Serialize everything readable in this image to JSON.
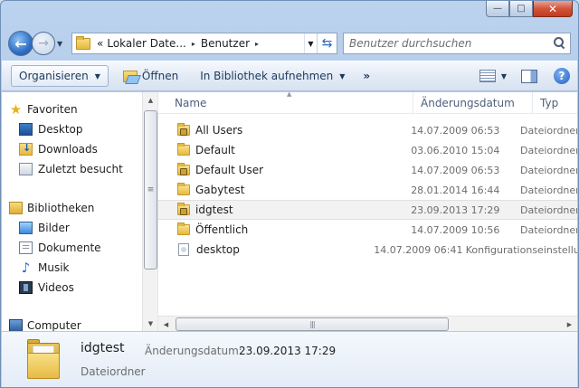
{
  "window": {
    "minimize_glyph": "—",
    "maximize_glyph": "□",
    "close_glyph": "✕"
  },
  "address_bar": {
    "overflow": "«",
    "segments": [
      "Lokaler Date...",
      "Benutzer"
    ],
    "separator": "▸"
  },
  "search": {
    "placeholder": "Benutzer durchsuchen"
  },
  "toolbar": {
    "organize_label": "Organisieren",
    "open_label": "Öffnen",
    "library_label": "In Bibliothek aufnehmen",
    "more_label": "»"
  },
  "navigation": {
    "favorites": {
      "label": "Favoriten",
      "items": [
        "Desktop",
        "Downloads",
        "Zuletzt besucht"
      ]
    },
    "libraries": {
      "label": "Bibliotheken",
      "items": [
        "Bilder",
        "Dokumente",
        "Musik",
        "Videos"
      ]
    },
    "computer": {
      "label": "Computer"
    }
  },
  "columns": {
    "name": "Name",
    "date": "Änderungsdatum",
    "type": "Typ"
  },
  "files": [
    {
      "name": "All Users",
      "date": "14.07.2009 06:53",
      "type": "Dateiordner",
      "icon": "folder-lock-icon"
    },
    {
      "name": "Default",
      "date": "03.06.2010 15:04",
      "type": "Dateiordner",
      "icon": "folder-icon"
    },
    {
      "name": "Default User",
      "date": "14.07.2009 06:53",
      "type": "Dateiordner",
      "icon": "folder-lock-icon"
    },
    {
      "name": "Gabytest",
      "date": "28.01.2014 16:44",
      "type": "Dateiordner",
      "icon": "folder-icon"
    },
    {
      "name": "idgtest",
      "date": "23.09.2013 17:29",
      "type": "Dateiordner",
      "icon": "folder-lock-icon",
      "selected": true
    },
    {
      "name": "Öffentlich",
      "date": "14.07.2009 10:56",
      "type": "Dateiordner",
      "icon": "folder-icon"
    },
    {
      "name": "desktop",
      "date": "14.07.2009 06:41",
      "type": "Konfigurationseinstellungen",
      "icon": "file-icon"
    }
  ],
  "details": {
    "name": "idgtest",
    "type": "Dateiordner",
    "date_label": "Änderungsdatum:",
    "date_value": "23.09.2013 17:29"
  }
}
